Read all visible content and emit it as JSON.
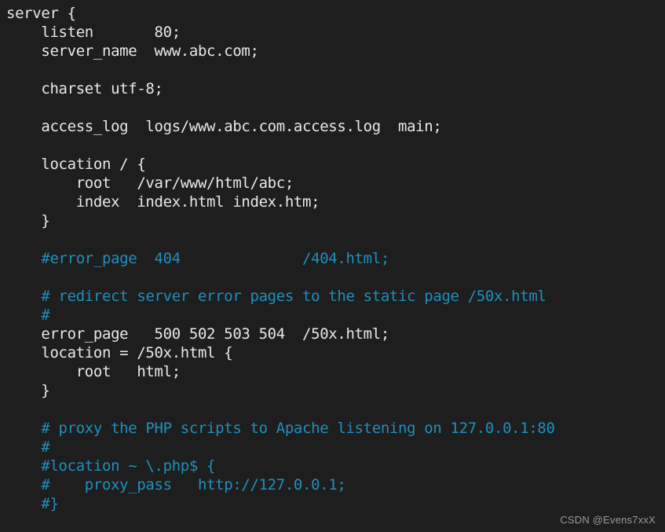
{
  "editor": {
    "background_color": "#1e1e1e",
    "code_color": "#e8e8e8",
    "comment_color": "#1f8fbf",
    "language": "nginx",
    "lines": [
      {
        "text": "server {",
        "kind": "code"
      },
      {
        "text": "    listen       80;",
        "kind": "code"
      },
      {
        "text": "    server_name  www.abc.com;",
        "kind": "code"
      },
      {
        "text": "",
        "kind": "blank"
      },
      {
        "text": "    charset utf-8;",
        "kind": "code"
      },
      {
        "text": "",
        "kind": "blank"
      },
      {
        "text": "    access_log  logs/www.abc.com.access.log  main;",
        "kind": "code"
      },
      {
        "text": "",
        "kind": "blank"
      },
      {
        "text": "    location / {",
        "kind": "code"
      },
      {
        "text": "        root   /var/www/html/abc;",
        "kind": "code"
      },
      {
        "text": "        index  index.html index.htm;",
        "kind": "code"
      },
      {
        "text": "    }",
        "kind": "code"
      },
      {
        "text": "",
        "kind": "blank"
      },
      {
        "text": "    #error_page  404              /404.html;",
        "kind": "comment"
      },
      {
        "text": "",
        "kind": "blank"
      },
      {
        "text": "    # redirect server error pages to the static page /50x.html",
        "kind": "comment"
      },
      {
        "text": "    #",
        "kind": "comment"
      },
      {
        "text": "    error_page   500 502 503 504  /50x.html;",
        "kind": "code"
      },
      {
        "text": "    location = /50x.html {",
        "kind": "code"
      },
      {
        "text": "        root   html;",
        "kind": "code"
      },
      {
        "text": "    }",
        "kind": "code"
      },
      {
        "text": "",
        "kind": "blank"
      },
      {
        "text": "    # proxy the PHP scripts to Apache listening on 127.0.0.1:80",
        "kind": "comment"
      },
      {
        "text": "    #",
        "kind": "comment"
      },
      {
        "text": "    #location ~ \\.php$ {",
        "kind": "comment"
      },
      {
        "text": "    #    proxy_pass   http://127.0.0.1;",
        "kind": "comment"
      },
      {
        "text": "    #}",
        "kind": "comment"
      }
    ]
  },
  "watermark": {
    "text": "CSDN @Evens7xxX"
  }
}
